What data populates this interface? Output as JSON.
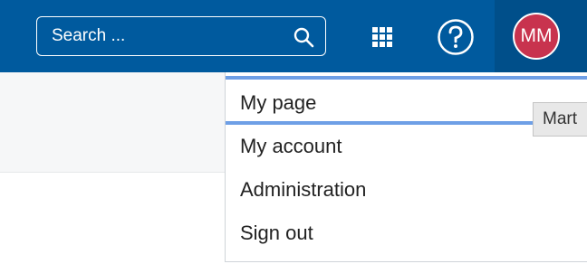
{
  "header": {
    "search": {
      "placeholder": "Search ..."
    },
    "avatar_initials": "MM"
  },
  "user_menu": {
    "items": [
      {
        "label": "My page",
        "active": true
      },
      {
        "label": "My account",
        "active": false
      },
      {
        "label": "Administration",
        "active": false
      },
      {
        "label": "Sign out",
        "active": false
      }
    ]
  },
  "tooltip": {
    "text": "Mart"
  },
  "colors": {
    "header_bg": "#005a9e",
    "avatar_bg": "#c8334e",
    "active_underline": "#6e9fe6"
  },
  "icons": [
    "search-icon",
    "modules-grid-icon",
    "help-icon"
  ]
}
